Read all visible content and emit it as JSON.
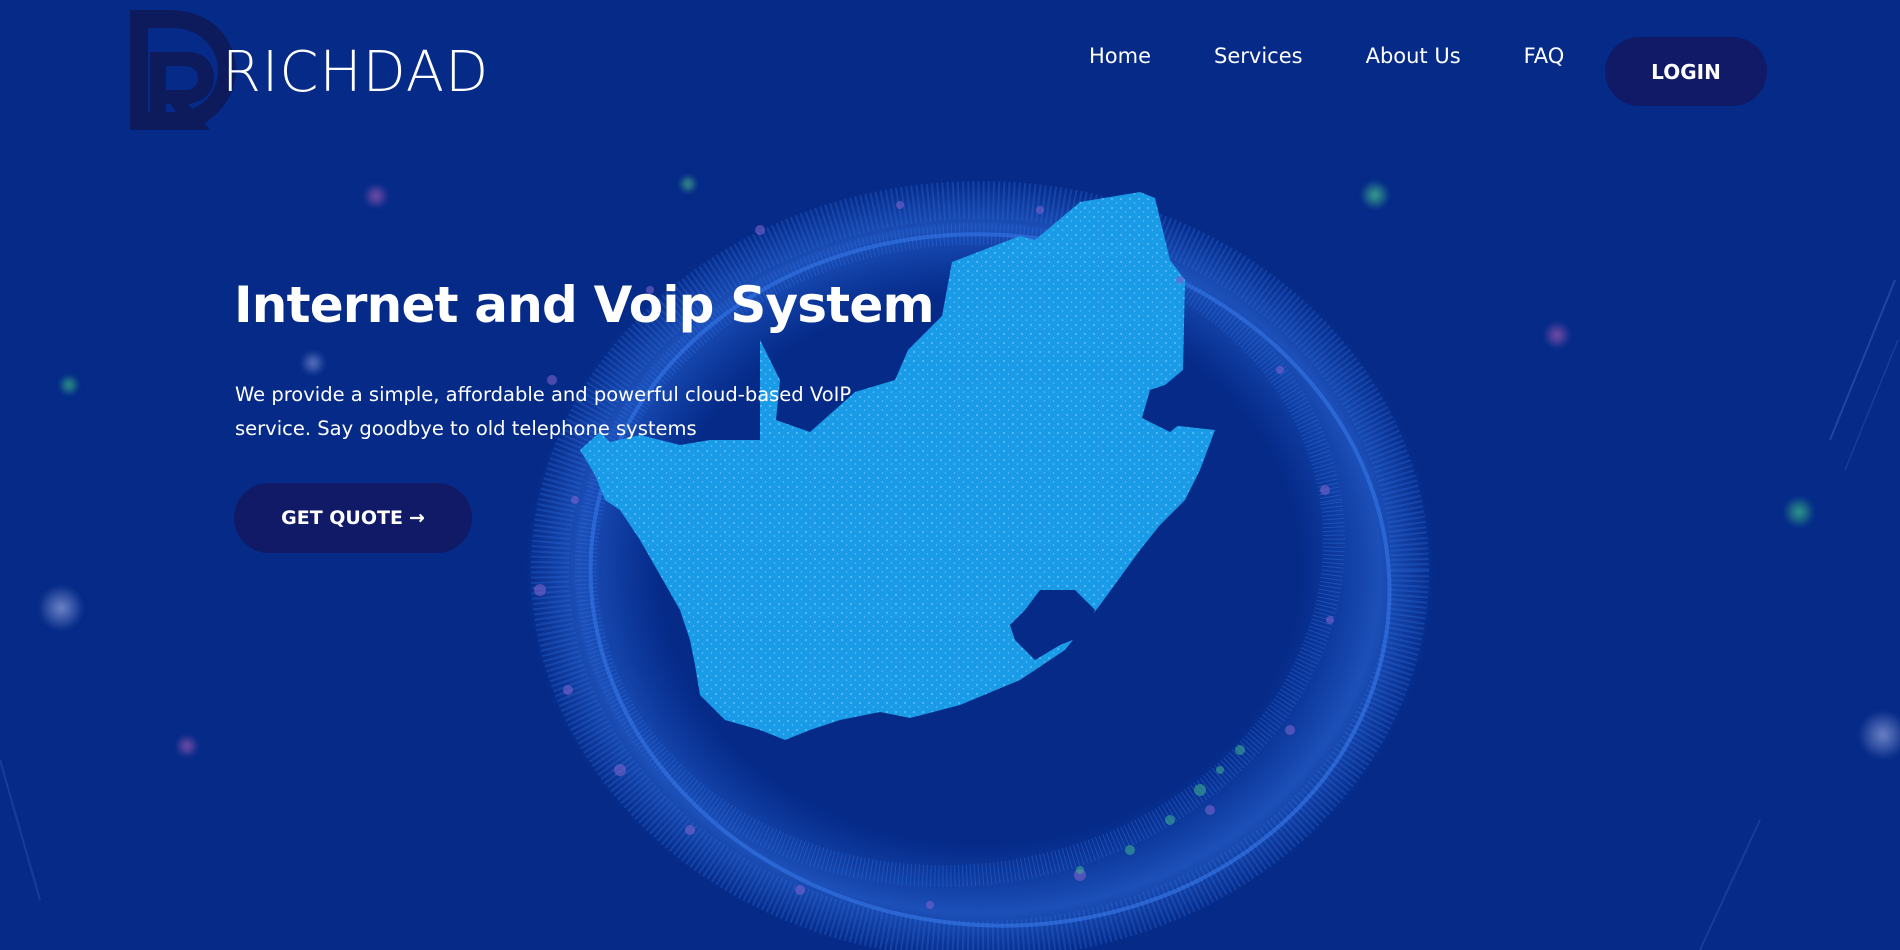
{
  "brand": {
    "name": "RICHDAD",
    "logo_icon": "rd-monogram-icon"
  },
  "nav": {
    "items": [
      {
        "label": "Home"
      },
      {
        "label": "Services"
      },
      {
        "label": "About Us"
      },
      {
        "label": "FAQ"
      }
    ],
    "login_label": "LOGIN"
  },
  "hero": {
    "title": "Internet and Voip System",
    "description": "We provide a simple, affordable and powerful cloud-based VoIP service. Say goodbye to old telephone systems",
    "cta_label": "GET QUOTE",
    "cta_icon": "arrow-right-icon"
  },
  "colors": {
    "background": "#052a88",
    "button": "#101a66",
    "map_fill": "#1a9be8",
    "ring": "#2f6fe0",
    "logo_mark": "#0d1a5c"
  }
}
